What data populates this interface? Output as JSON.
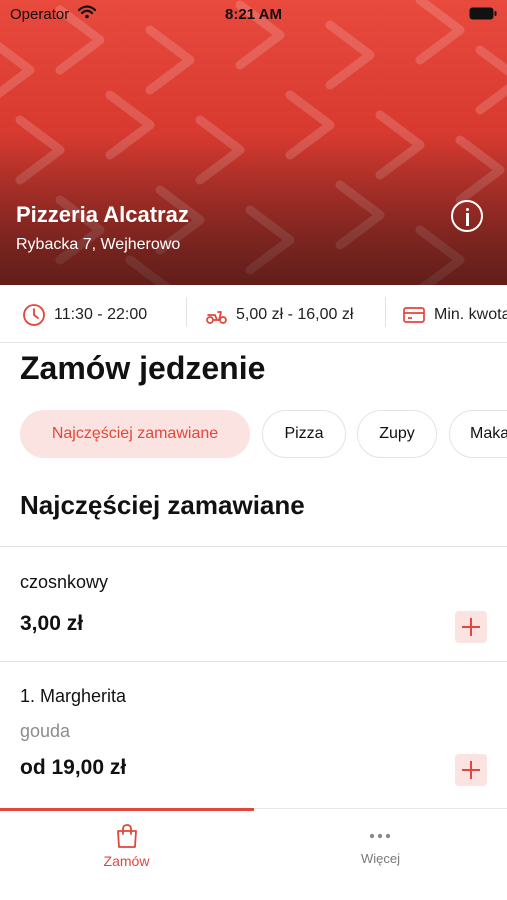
{
  "status_bar": {
    "carrier": "Operator",
    "time": "8:21 AM"
  },
  "header": {
    "restaurant_name": "Pizzeria Alcatraz",
    "address": "Rybacka  7, Wejherowo",
    "info_icon": "info-icon"
  },
  "info_strip": {
    "hours": "11:30 - 22:00",
    "delivery_cost": "5,00 zł - 16,00 zł",
    "min_order": "Min. kwota"
  },
  "page_title": "Zamów jedzenie",
  "categories": [
    "Najczęściej zamawiane",
    "Pizza",
    "Zupy",
    "Makarony"
  ],
  "section_title": "Najczęściej zamawiane",
  "items": [
    {
      "name": "czosnkowy",
      "price": "3,00 zł"
    },
    {
      "name": "1. Margherita",
      "description": "gouda",
      "price": "od 19,00 zł"
    }
  ],
  "tabbar": {
    "orders_label": "Zamów",
    "more_label": "Więcej"
  },
  "colors": {
    "accent": "#e3463a",
    "accent_light": "#fbe3e1",
    "hero": "#d83a30"
  }
}
